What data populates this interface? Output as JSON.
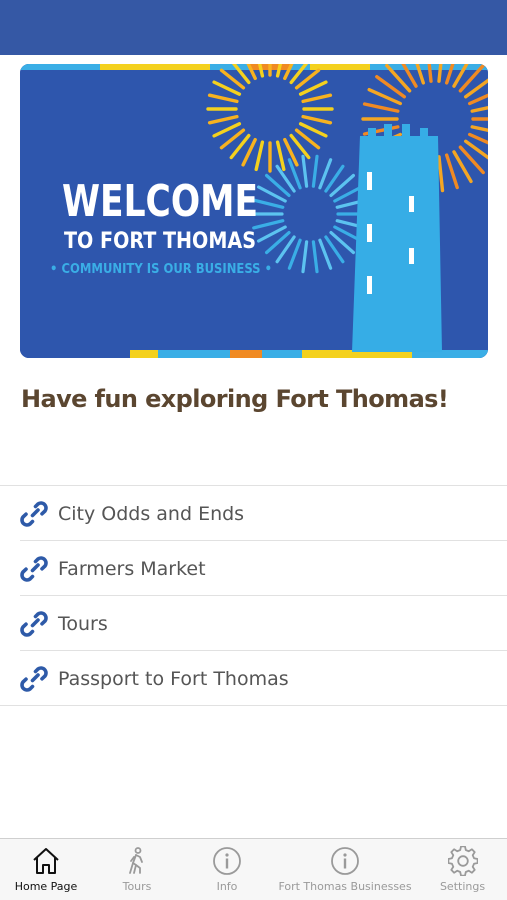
{
  "colors": {
    "header_bar": "#3558a5",
    "banner_bg": "#2e56ad",
    "headline_text": "#5b4630",
    "link_icon": "#2e5aa8",
    "tab_active": "#111111",
    "tab_inactive": "#9a9a9a"
  },
  "banner": {
    "line1": "WELCOME",
    "line2": "TO FORT THOMAS",
    "tagline": "• COMMUNITY IS OUR BUSINESS •"
  },
  "headline": "Have fun exploring Fort Thomas!",
  "links": [
    {
      "label": "City Odds and Ends",
      "icon": "link-icon"
    },
    {
      "label": "Farmers Market",
      "icon": "link-icon"
    },
    {
      "label": "Tours",
      "icon": "link-icon"
    },
    {
      "label": "Passport to Fort Thomas",
      "icon": "link-icon"
    }
  ],
  "tabs": [
    {
      "label": "Home Page",
      "icon": "home-icon",
      "active": true
    },
    {
      "label": "Tours",
      "icon": "hiker-icon",
      "active": false
    },
    {
      "label": "Info",
      "icon": "info-icon",
      "active": false
    },
    {
      "label": "Fort Thomas Businesses",
      "icon": "info-icon",
      "active": false
    },
    {
      "label": "Settings",
      "icon": "gear-icon",
      "active": false
    }
  ]
}
